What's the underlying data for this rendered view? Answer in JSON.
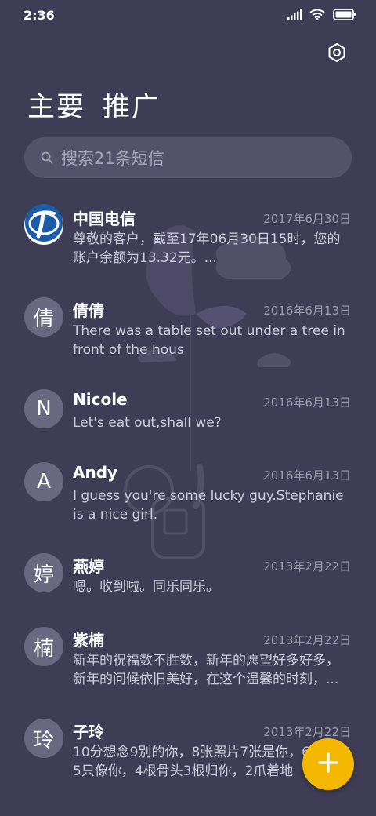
{
  "colors": {
    "background": "#3f3d56",
    "search_background": "#54526a",
    "avatar_background": "#6a6881",
    "fab": "#f5b800",
    "telecom_blue": "#1b5ca8"
  },
  "status_bar": {
    "time": "2:36",
    "icons": [
      "signal-icon",
      "wifi-icon",
      "battery-icon"
    ]
  },
  "header": {
    "settings_icon": "settings-icon",
    "tabs": [
      {
        "label": "主要"
      },
      {
        "label": "推广"
      }
    ]
  },
  "search": {
    "placeholder": "搜索21条短信"
  },
  "conversations": [
    {
      "avatar": "",
      "avatar_icon": "china-telecom-logo",
      "name": "中国电信",
      "date": "2017年6月30日",
      "preview": "尊敬的客户，截至17年06月30日15时，您的账户余额为13.32元。..."
    },
    {
      "avatar": "倩",
      "name": "倩倩",
      "date": "2016年6月13日",
      "preview": "There was a table set out under a tree in front of the hous"
    },
    {
      "avatar": "N",
      "name": "Nicole",
      "date": "2016年6月13日",
      "preview": "Let's eat out,shall we?"
    },
    {
      "avatar": "A",
      "name": "Andy",
      "date": "2016年6月13日",
      "preview": "I guess you're some lucky guy.Stephanie is a nice girl."
    },
    {
      "avatar": "婷",
      "name": "燕婷",
      "date": "2013年2月22日",
      "preview": "嗯。收到啦。同乐同乐。"
    },
    {
      "avatar": "楠",
      "name": "紫楠",
      "date": "2013年2月22日",
      "preview": "新年的祝福数不胜数，新年的愿望好多好多，新年的问候依旧美好，在这个温馨的时刻，..."
    },
    {
      "avatar": "玲",
      "name": "子玲",
      "date": "2013年2月22日",
      "preview": "10分想念9别的你，8张照片7张是你，6条小狗5只像你，4根骨头3根归你，2爪着地"
    }
  ],
  "fab": {
    "icon": "plus-icon"
  }
}
